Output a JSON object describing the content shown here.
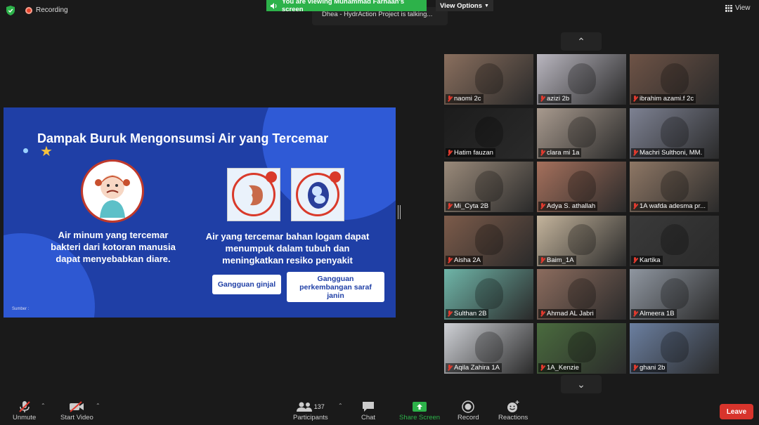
{
  "top": {
    "recording": "Recording",
    "viewing_banner": "You are viewing Muhammad Farhaan's screen",
    "view_options": "View Options",
    "talking": "Dhea - HydrAction Project is talking...",
    "view": "View"
  },
  "slide": {
    "title": "Dampak Buruk Mengonsumsi Air yang Tercemar",
    "caption_left": "Air minum yang tercemar bakteri dari kotoran manusia dapat menyebabkan diare.",
    "caption_right": "Air yang tercemar bahan logam dapat menumpuk dalam tubuh dan meningkatkan resiko penyakit",
    "pill_1": "Gangguan ginjal",
    "pill_2": "Gangguan perkembangan saraf janin",
    "source": "Sumber :"
  },
  "participants": [
    {
      "name": "naomi 2c",
      "color": "#8a6f5e"
    },
    {
      "name": "azizi 2b",
      "color": "#b9b6bf"
    },
    {
      "name": "ibrahim azami.f 2c",
      "color": "#6e5346"
    },
    {
      "name": "Hatim fauzan",
      "color": "#1c1c1c"
    },
    {
      "name": "clara mi 1a",
      "color": "#a89a8e"
    },
    {
      "name": "Machri Sulthoni, MM.",
      "color": "#7d8192"
    },
    {
      "name": "Mi_Cyta 2B",
      "color": "#9a8a7a"
    },
    {
      "name": "Adya S. athallah",
      "color": "#a5705c"
    },
    {
      "name": "1A wafda adesma pr...",
      "color": "#8e7765"
    },
    {
      "name": "Aisha 2A",
      "color": "#7c5b4a"
    },
    {
      "name": "Baim_1A",
      "color": "#c4b49c"
    },
    {
      "name": "Kartika",
      "color": "#3a3a3a"
    },
    {
      "name": "Sulthan 2B",
      "color": "#6fb5a8"
    },
    {
      "name": "Ahmad AL Jabri",
      "color": "#8c6c5e"
    },
    {
      "name": "Almeera 1B",
      "color": "#8f96a0"
    },
    {
      "name": "Aqila Zahira 1A",
      "color": "#cfd1d6"
    },
    {
      "name": "1A_Kenzie",
      "color": "#4a6b3e"
    },
    {
      "name": "ghani 2b",
      "color": "#6b7fa0"
    }
  ],
  "toolbar": {
    "unmute": "Unmute",
    "start_video": "Start Video",
    "participants": "Participants",
    "participants_count": "137",
    "chat": "Chat",
    "share_screen": "Share Screen",
    "record": "Record",
    "reactions": "Reactions",
    "leave": "Leave"
  }
}
